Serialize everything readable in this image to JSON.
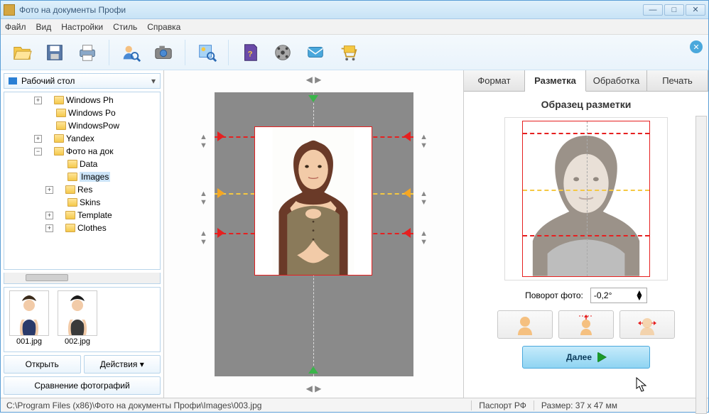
{
  "title": "Фото на документы Профи",
  "menu": [
    "Файл",
    "Вид",
    "Настройки",
    "Стиль",
    "Справка"
  ],
  "sidebar": {
    "combo": "Рабочий стол",
    "tree": [
      {
        "label": "Windows Ph",
        "exp": "+",
        "depth": 1
      },
      {
        "label": "Windows Po",
        "exp": null,
        "depth": 1
      },
      {
        "label": "WindowsPow",
        "exp": null,
        "depth": 1
      },
      {
        "label": "Yandex",
        "exp": "+",
        "depth": 1
      },
      {
        "label": "Фото на док",
        "exp": "−",
        "depth": 1
      },
      {
        "label": "Data",
        "exp": null,
        "depth": 2
      },
      {
        "label": "Images",
        "exp": null,
        "depth": 2,
        "selected": true
      },
      {
        "label": "Res",
        "exp": "+",
        "depth": 2
      },
      {
        "label": "Skins",
        "exp": null,
        "depth": 2
      },
      {
        "label": "Template",
        "exp": "+",
        "depth": 2
      },
      {
        "label": "Clothes",
        "exp": "+",
        "depth": 2
      }
    ],
    "thumbs": [
      "001.jpg",
      "002.jpg"
    ],
    "open_btn": "Открыть",
    "actions_btn": "Действия",
    "compare_btn": "Сравнение фотографий"
  },
  "tabs": [
    "Формат",
    "Разметка",
    "Обработка",
    "Печать"
  ],
  "panel": {
    "heading": "Образец разметки",
    "rotate_label": "Поворот фото:",
    "rotate_value": "-0,2°",
    "next": "Далее"
  },
  "status": {
    "path": "C:\\Program Files (x86)\\Фото на документы Профи\\Images\\003.jpg",
    "format": "Паспорт РФ",
    "size": "Размер: 37 x 47 мм"
  }
}
